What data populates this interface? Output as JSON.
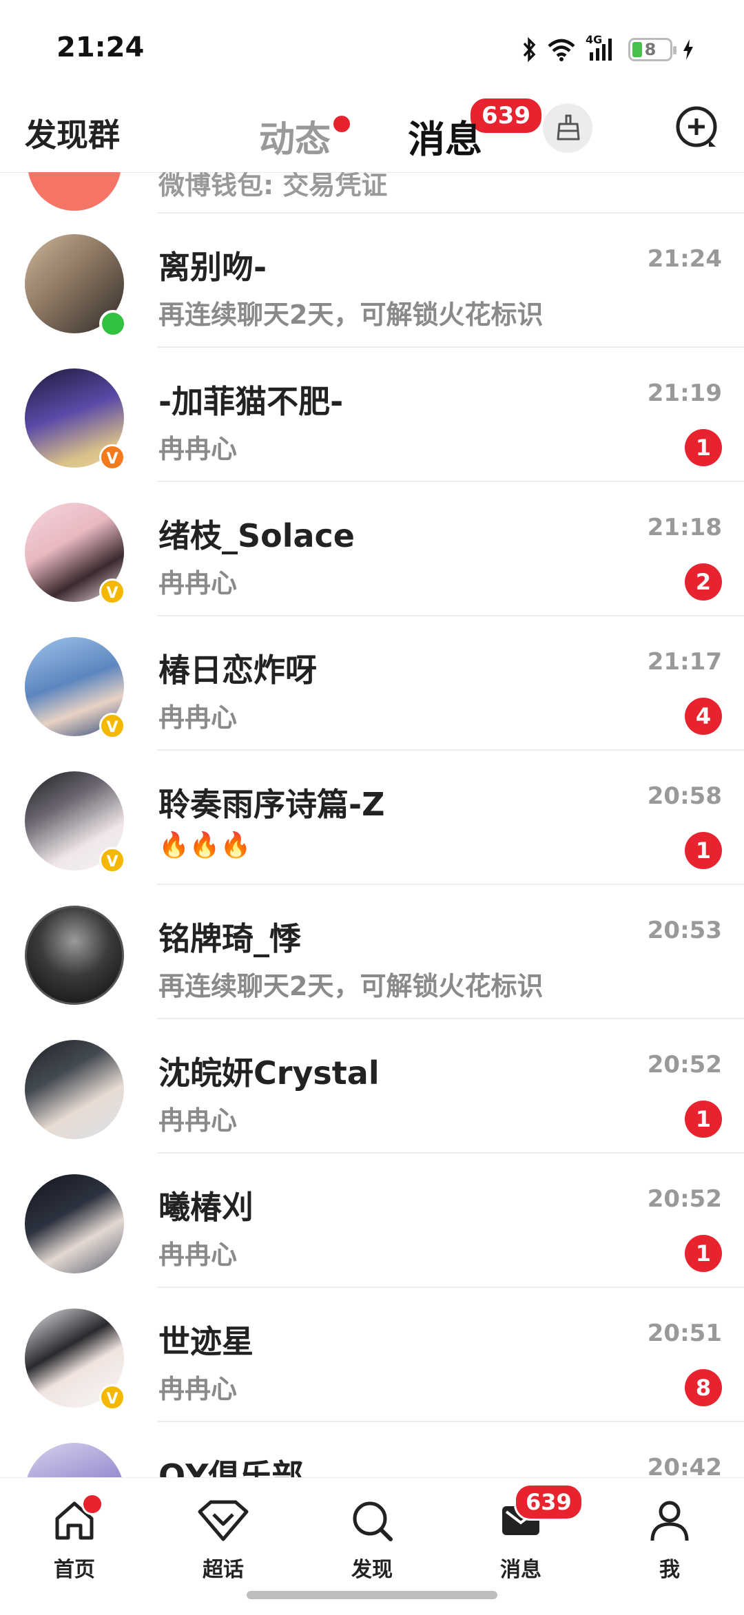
{
  "status_bar": {
    "time": "21:24",
    "network": "4G",
    "battery": "8"
  },
  "top_nav": {
    "left_label": "发现群",
    "tab_feed": "动态",
    "tab_messages": "消息",
    "messages_badge": "639"
  },
  "partial_top_msg": "微博钱包: 交易凭证",
  "conversations": [
    {
      "name": "离别吻-",
      "message": "再连续聊天2天，可解锁火花标识",
      "time": "21:24",
      "unread": "",
      "badge": "online"
    },
    {
      "name": "-加菲猫不肥-",
      "message": "冉冉心",
      "time": "21:19",
      "unread": "1",
      "badge": "v-orange"
    },
    {
      "name": "绪枝_Solace",
      "message": "冉冉心",
      "time": "21:18",
      "unread": "2",
      "badge": "v-gold"
    },
    {
      "name": "椿日恋炸呀",
      "message": "冉冉心",
      "time": "21:17",
      "unread": "4",
      "badge": "v-gold"
    },
    {
      "name": "聆奏雨序诗篇-Z",
      "message": "🔥🔥🔥",
      "time": "20:58",
      "unread": "1",
      "badge": "v-gold"
    },
    {
      "name": "铭牌琦_悸",
      "message": "再连续聊天2天，可解锁火花标识",
      "time": "20:53",
      "unread": "",
      "badge": ""
    },
    {
      "name": "沈皖妍Crystal",
      "message": "冉冉心",
      "time": "20:52",
      "unread": "1",
      "badge": ""
    },
    {
      "name": "曦椿刈",
      "message": "冉冉心",
      "time": "20:52",
      "unread": "1",
      "badge": ""
    },
    {
      "name": "世迹星",
      "message": "冉冉心",
      "time": "20:51",
      "unread": "8",
      "badge": "v-gold"
    },
    {
      "name": "QY俱乐部",
      "message": "",
      "time": "20:42",
      "unread": "",
      "badge": ""
    }
  ],
  "bottom_nav": {
    "home": "首页",
    "super_topic": "超话",
    "discover": "发现",
    "messages": "消息",
    "messages_badge": "639",
    "me": "我"
  },
  "icons": [
    "bluetooth-icon",
    "wifi-icon",
    "cell-signal-icon",
    "battery-icon",
    "charging-icon",
    "broom-icon",
    "add-chat-icon",
    "home-icon",
    "diamond-icon",
    "search-icon",
    "message-icon",
    "person-icon"
  ],
  "colors": {
    "accent_red": "#e6232f",
    "tab_underline": "#ffb300",
    "vip_gold": "#f5b800",
    "vip_orange": "#f37b1d",
    "online_green": "#33c23f"
  }
}
